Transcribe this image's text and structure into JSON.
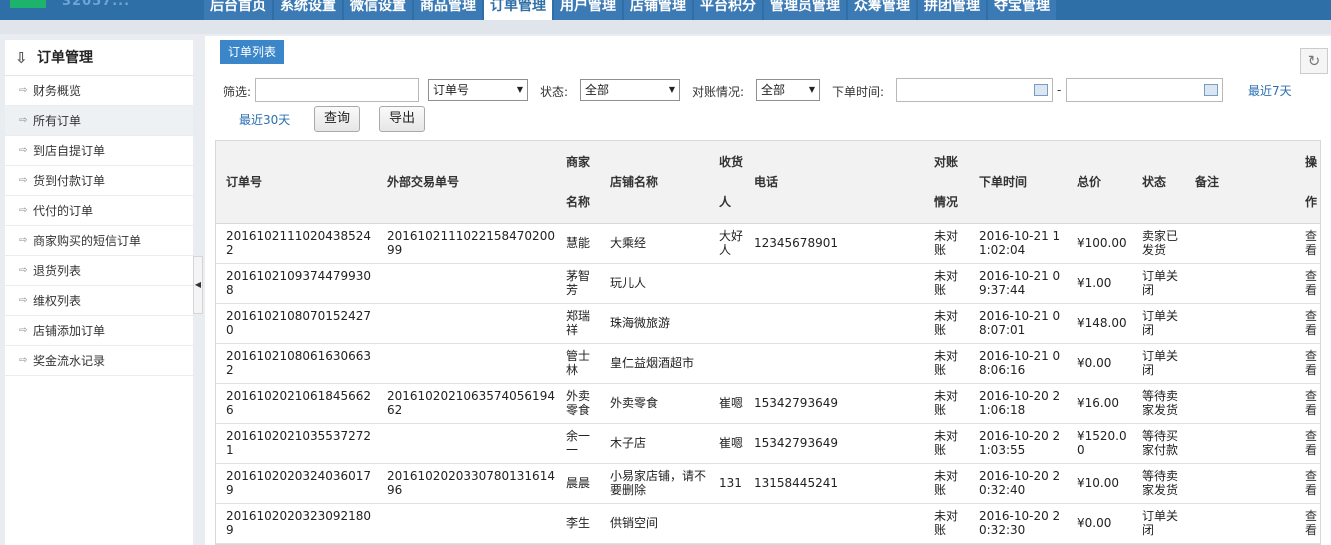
{
  "nav": {
    "logo_text": "32057... ",
    "items": [
      "后台首页",
      "系统设置",
      "微信设置",
      "商品管理",
      "订单管理",
      "用户管理",
      "店铺管理",
      "平台积分",
      "管理员管理",
      "众筹管理",
      "拼团管理",
      "夺宝管理"
    ],
    "active_index": 4
  },
  "sidebar": {
    "title": "订单管理",
    "items": [
      "财务概览",
      "所有订单",
      "到店自提订单",
      "货到付款订单",
      "代付的订单",
      "商家购买的短信订单",
      "退货列表",
      "维权列表",
      "店铺添加订单",
      "奖金流水记录"
    ],
    "active_index": 1
  },
  "tab": {
    "label": "订单列表"
  },
  "filter": {
    "filter_label": "筛选:",
    "filter_value": "",
    "field_select": "订单号",
    "status_label": "状态:",
    "status_select": "全部",
    "recon_label": "对账情况:",
    "recon_select": "全部",
    "time_label": "下单时间:",
    "date_sep": "-",
    "recent7": "最近7天",
    "recent30": "最近30天",
    "query_btn": "查询",
    "export_btn": "导出"
  },
  "table": {
    "headers": {
      "order_no": "订单号",
      "ext_no": "外部交易单号",
      "merchant_1": "商家",
      "merchant_2": "名称",
      "shop": "店铺名称",
      "recv_1": "收货",
      "recv_2": "人",
      "phone": "电话",
      "recon_1": "对账",
      "recon_2": "情况",
      "time": "下单时间",
      "total": "总价",
      "status": "状态",
      "remark": "备注",
      "op_1": "操",
      "op_2": "作"
    },
    "rows": [
      {
        "order_no": "20161021110204385242",
        "ext_no": "20161021110221584702009​9",
        "merchant": "慧能",
        "shop": "大乘经",
        "recv": "大好人",
        "phone": "12345678901",
        "recon": "未对账",
        "time": "2016-10-21 11:02:04",
        "total": "¥100.00",
        "status": "卖家已发货",
        "remark": "",
        "op": "查看"
      },
      {
        "order_no": "20161021093744799308",
        "ext_no": "",
        "merchant": "茅智芳",
        "shop": "玩儿人",
        "recv": "",
        "phone": "",
        "recon": "未对账",
        "time": "2016-10-21 09:37:44",
        "total": "¥1.00",
        "status": "订单关闭",
        "remark": "",
        "op": "查看"
      },
      {
        "order_no": "20161021080701524270",
        "ext_no": "",
        "merchant": "郑瑞祥",
        "shop": "珠海微旅游",
        "recv": "",
        "phone": "",
        "recon": "未对账",
        "time": "2016-10-21 08:07:01",
        "total": "¥148.00",
        "status": "订单关闭",
        "remark": "",
        "op": "查看"
      },
      {
        "order_no": "20161021080616306632",
        "ext_no": "",
        "merchant": "管士林",
        "shop": "皇仁益烟酒超市",
        "recv": "",
        "phone": "",
        "recon": "未对账",
        "time": "2016-10-21 08:06:16",
        "total": "¥0.00",
        "status": "订单关闭",
        "remark": "",
        "op": "查看"
      },
      {
        "order_no": "20161020210618456626",
        "ext_no": "20161020210635740561946​2",
        "merchant": "外卖零食",
        "shop": "外卖零食",
        "recv": "崔嗯",
        "phone": "15342793649",
        "recon": "未对账",
        "time": "2016-10-20 21:06:18",
        "total": "¥16.00",
        "status": "等待卖家发货",
        "remark": "",
        "op": "查看"
      },
      {
        "order_no": "20161020210355372721",
        "ext_no": "",
        "merchant": "余一一",
        "shop": "木子店",
        "recv": "崔嗯",
        "phone": "15342793649",
        "recon": "未对账",
        "time": "2016-10-20 21:03:55",
        "total": "¥1520.00",
        "status": "等待买家付款",
        "remark": "",
        "op": "查看"
      },
      {
        "order_no": "20161020203240360179",
        "ext_no": "20161020203307801316149​6",
        "merchant": "晨晨",
        "shop": "小易家店铺，请不要删除",
        "recv": "131",
        "phone": "13158445241",
        "recon": "未对账",
        "time": "2016-10-20 20:32:40",
        "total": "¥10.00",
        "status": "等待卖家发货",
        "remark": "",
        "op": "查看"
      },
      {
        "order_no": "20161020203230921809",
        "ext_no": "",
        "merchant": "李生",
        "shop": "供销空间",
        "recv": "",
        "phone": "",
        "recon": "未对账",
        "time": "2016-10-20 20:32:30",
        "total": "¥0.00",
        "status": "订单关闭",
        "remark": "",
        "op": "查看"
      }
    ]
  }
}
